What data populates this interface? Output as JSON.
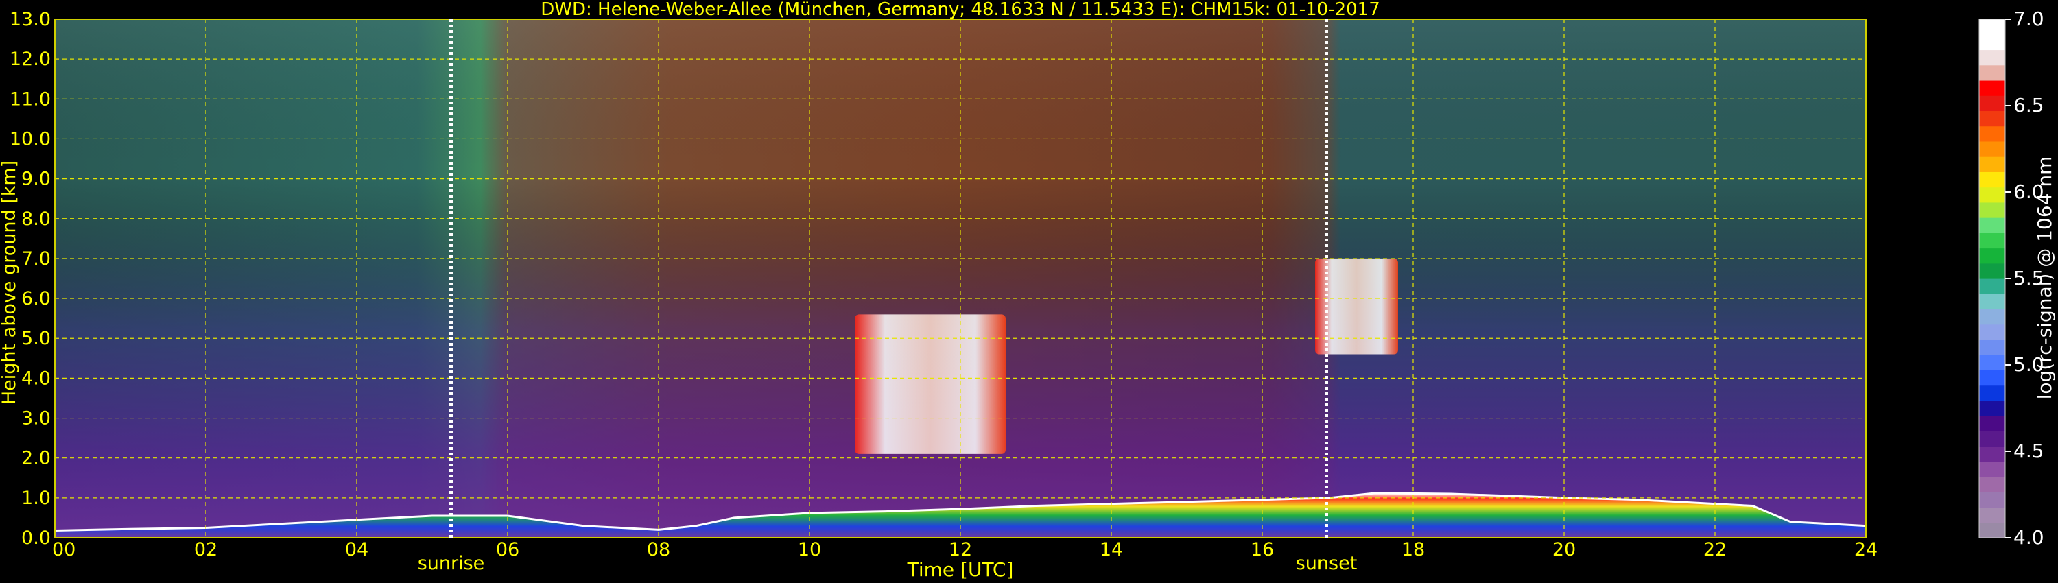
{
  "chart_data": {
    "type": "heatmap",
    "title": "DWD: Helene-Weber-Allee (München, Germany; 48.1633 N / 11.5433 E):    CHM15k: 01-10-2017",
    "xlabel": "Time [UTC]",
    "ylabel": "Height above ground [km]",
    "xlim": [
      0,
      24
    ],
    "ylim": [
      0,
      13
    ],
    "x_ticks": [
      "00",
      "02",
      "04",
      "06",
      "08",
      "10",
      "12",
      "14",
      "16",
      "18",
      "20",
      "22",
      "24"
    ],
    "y_ticks": [
      "0.0",
      "1.0",
      "2.0",
      "3.0",
      "4.0",
      "5.0",
      "6.0",
      "7.0",
      "8.0",
      "9.0",
      "10.0",
      "11.0",
      "12.0",
      "13.0"
    ],
    "grid": true,
    "colorbar": {
      "label": "log(rc-signal) @ 1064 nm",
      "range": [
        4.0,
        7.0
      ],
      "ticks": [
        "4.0",
        "4.5",
        "5.0",
        "5.5",
        "6.0",
        "6.5",
        "7.0"
      ],
      "colors": [
        "#9a8aa6",
        "#a58bb0",
        "#9a78b0",
        "#9f6aa8",
        "#8e4fa4",
        "#6f2b94",
        "#5a1a8c",
        "#4b0a86",
        "#1a10a0",
        "#0a38e0",
        "#2b5cff",
        "#4f7bff",
        "#6f8ff2",
        "#8fa3ea",
        "#8cb0e0",
        "#76c8c8",
        "#2fae90",
        "#0f9e44",
        "#16b43a",
        "#35cc4e",
        "#63e07a",
        "#a8e83a",
        "#e0ef1a",
        "#ffe70a",
        "#ffb306",
        "#ff8f04",
        "#ff6a04",
        "#f23a10",
        "#e81a14",
        "#ff0000",
        "#e8b2a8",
        "#f0e0e0",
        "#ffffff",
        "#ffffff"
      ]
    },
    "annotations": [
      {
        "text": "sunrise",
        "x": 5.25
      },
      {
        "text": "sunset",
        "x": 16.85
      }
    ],
    "boundary_layer_km": [
      [
        0.0,
        0.18
      ],
      [
        1.0,
        0.22
      ],
      [
        2.0,
        0.25
      ],
      [
        3.0,
        0.35
      ],
      [
        4.0,
        0.45
      ],
      [
        5.0,
        0.55
      ],
      [
        6.0,
        0.55
      ],
      [
        7.0,
        0.3
      ],
      [
        8.0,
        0.2
      ],
      [
        8.5,
        0.3
      ],
      [
        9.0,
        0.5
      ],
      [
        10.0,
        0.62
      ],
      [
        11.0,
        0.66
      ],
      [
        12.0,
        0.72
      ],
      [
        13.0,
        0.8
      ],
      [
        14.0,
        0.85
      ],
      [
        15.0,
        0.9
      ],
      [
        16.0,
        0.95
      ],
      [
        16.9,
        1.0
      ],
      [
        17.5,
        1.12
      ],
      [
        18.5,
        1.1
      ],
      [
        20.0,
        1.0
      ],
      [
        21.0,
        0.95
      ],
      [
        22.0,
        0.85
      ],
      [
        22.5,
        0.8
      ],
      [
        23.0,
        0.4
      ],
      [
        24.0,
        0.3
      ]
    ],
    "cloud_layers": [
      {
        "x0": 10.6,
        "x1": 12.6,
        "base": 2.1,
        "top": 5.6
      },
      {
        "x0": 16.7,
        "x1": 17.8,
        "base": 4.6,
        "top": 7.0
      }
    ]
  }
}
